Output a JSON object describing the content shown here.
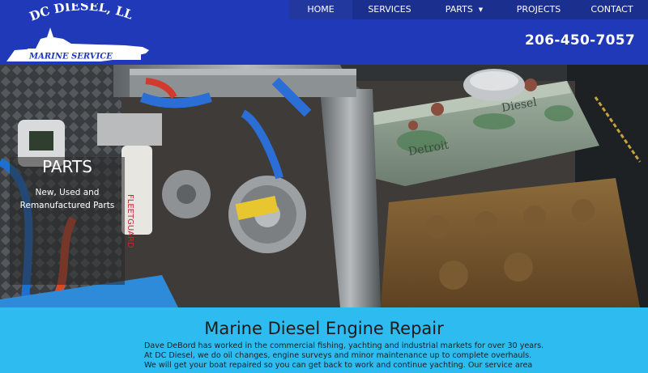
{
  "brand": {
    "name": "DC DIESEL, LLC",
    "tagline": "MARINE SERVICE"
  },
  "nav": {
    "items": [
      {
        "label": "HOME"
      },
      {
        "label": "SERVICES"
      },
      {
        "label": "PARTS"
      },
      {
        "label": "PROJECTS"
      },
      {
        "label": "CONTACT"
      }
    ]
  },
  "header": {
    "phone": "206-450-7057"
  },
  "hero": {
    "card_title": "PARTS",
    "card_subtitle_line1": "New, Used and",
    "card_subtitle_line2": "Remanufactured Parts",
    "engine_plate_text": "Detroit Diesel"
  },
  "content": {
    "title": "Marine Diesel Engine Repair",
    "lines": [
      "Dave DeBord has worked in the commercial fishing, yachting and industrial markets for over 30 years.",
      "At DC Diesel, we do oil changes, engine surveys and minor maintenance up to complete overhauls.",
      "We will get your boat repaired so you can get back to work and continue yachting. Our service area"
    ]
  },
  "colors": {
    "header_bg": "#1f39b8",
    "nav_bg": "#1b2f8e",
    "content_bg": "#2ebcf0"
  }
}
